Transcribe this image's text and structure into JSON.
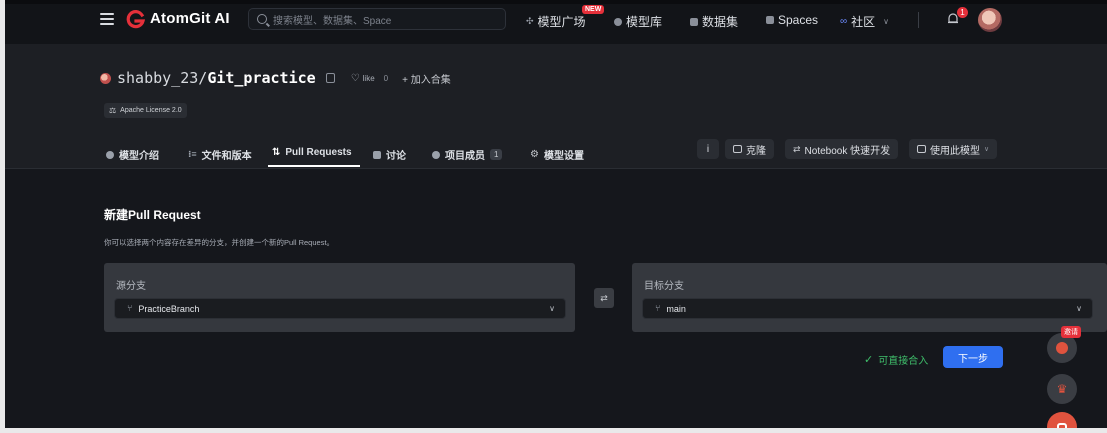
{
  "nav": {
    "brand": "AtomGit AI",
    "search_placeholder": "搜索模型、数据集、Space",
    "items": [
      {
        "label": "模型广场"
      },
      {
        "label": "模型库"
      },
      {
        "label": "数据集"
      },
      {
        "label": "Spaces"
      },
      {
        "label": "社区"
      }
    ],
    "new_badge": "NEW",
    "notification_count": "1"
  },
  "repo": {
    "owner": "shabby_23/",
    "name": "Git_practice",
    "like_label": "like",
    "like_count": "0",
    "add_collection": "+ 加入合集",
    "license": "Apache License 2.0"
  },
  "tabs": [
    {
      "label": "模型介绍"
    },
    {
      "label": "文件和版本"
    },
    {
      "label": "Pull Requests"
    },
    {
      "label": "讨论"
    },
    {
      "label": "项目成员",
      "count": "1"
    },
    {
      "label": "模型设置"
    }
  ],
  "actions": {
    "info": "i",
    "clone": "克隆",
    "notebook": "Notebook 快速开发",
    "use_model": "使用此模型"
  },
  "pr": {
    "title": "新建Pull Request",
    "description": "你可以选择两个内容存在差异的分支，并创建一个新的Pull Request。",
    "source_label": "源分支",
    "source_value": "PracticeBranch",
    "target_label": "目标分支",
    "target_value": "main",
    "mergeable_text": "可直接合入",
    "next_button": "下一步"
  },
  "floating": {
    "invite_badge": "邀请"
  }
}
